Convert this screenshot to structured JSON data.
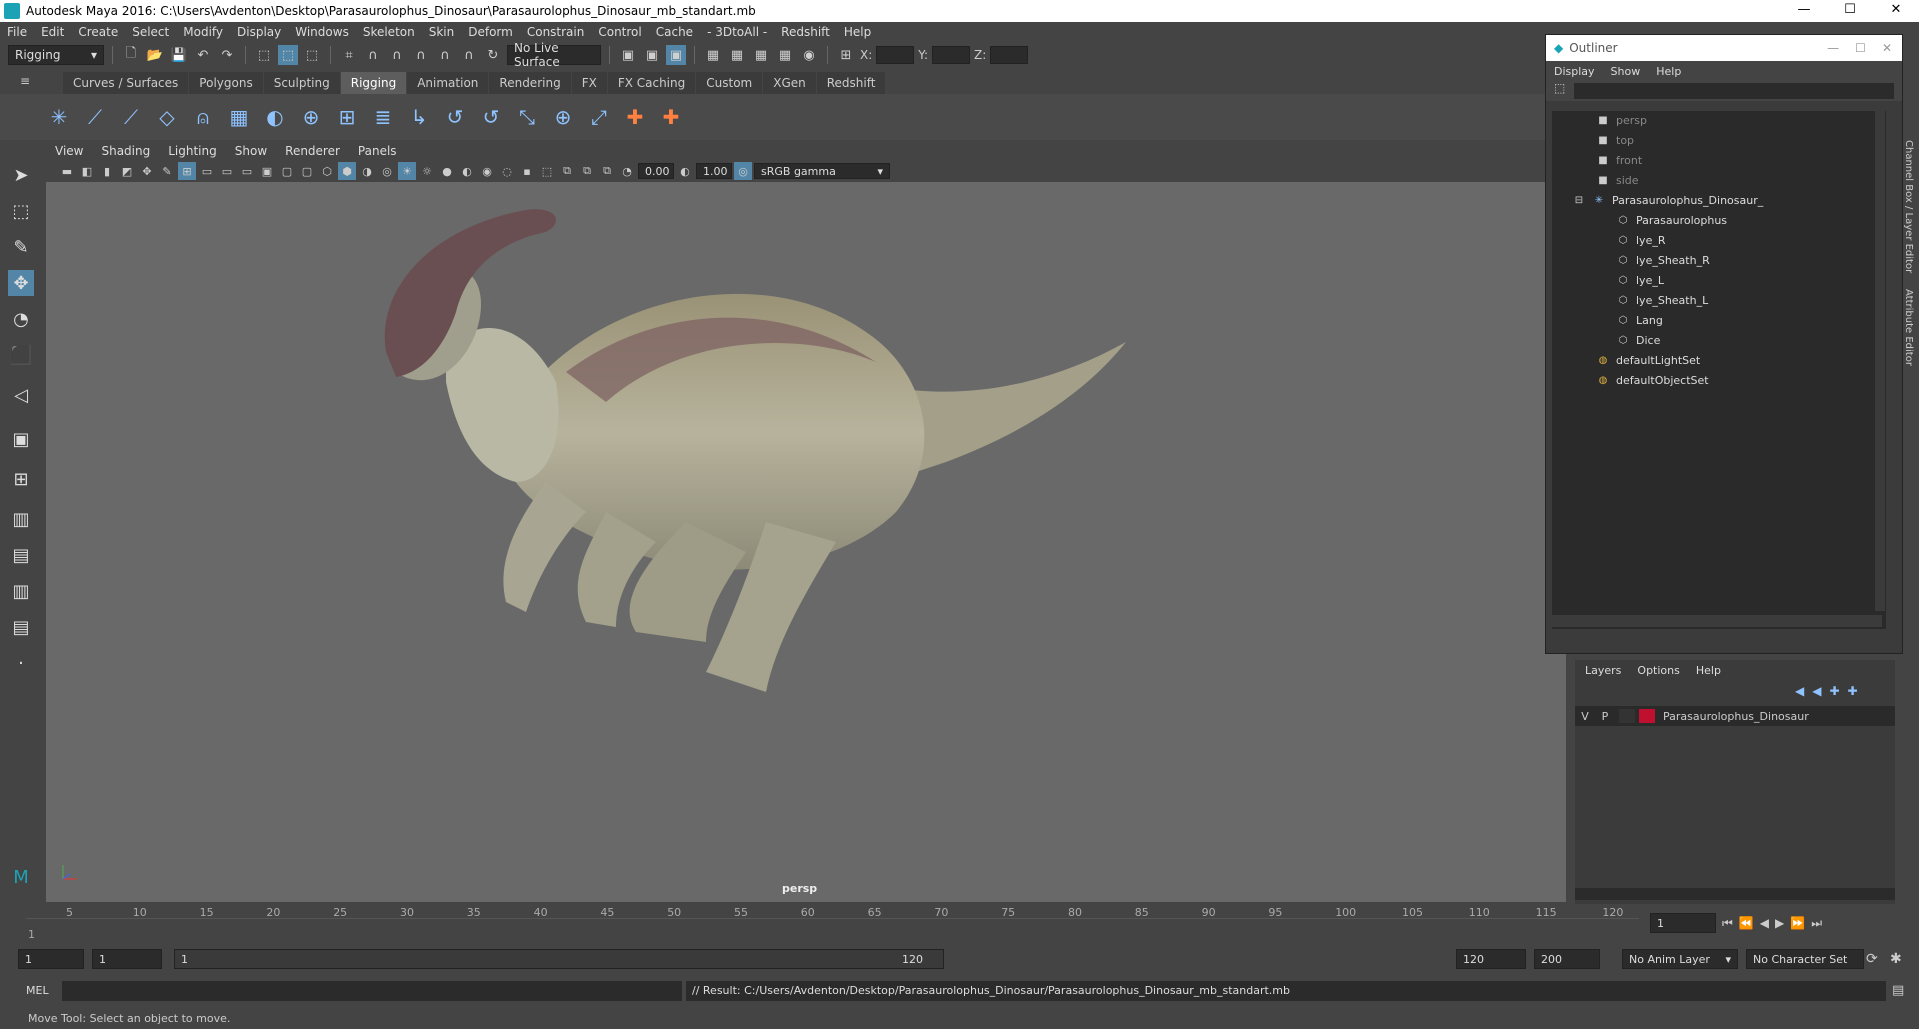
{
  "window": {
    "title": "Autodesk Maya 2016: C:\\Users\\Avdenton\\Desktop\\Parasaurolophus_Dinosaur\\Parasaurolophus_Dinosaur_mb_standart.mb",
    "minimize": "—",
    "maximize": "☐",
    "close": "✕"
  },
  "menubar": [
    "File",
    "Edit",
    "Create",
    "Select",
    "Modify",
    "Display",
    "Windows",
    "Skeleton",
    "Skin",
    "Deform",
    "Constrain",
    "Control",
    "Cache",
    "- 3DtoAll -",
    "Redshift",
    "Help"
  ],
  "status": {
    "mode": "Rigging",
    "live_surface": "No Live Surface",
    "x_label": "X:",
    "y_label": "Y:",
    "z_label": "Z:"
  },
  "shelf_tabs": [
    "Curves / Surfaces",
    "Polygons",
    "Sculpting",
    "Rigging",
    "Animation",
    "Rendering",
    "FX",
    "FX Caching",
    "Custom",
    "XGen",
    "Redshift"
  ],
  "shelf_active": "Rigging",
  "viewport": {
    "menu": [
      "View",
      "Shading",
      "Lighting",
      "Show",
      "Renderer",
      "Panels"
    ],
    "exposure": "0.00",
    "gamma": "1.00",
    "color_space": "sRGB gamma",
    "camera": "persp"
  },
  "timeline": {
    "ticks": [
      "5",
      "10",
      "15",
      "20",
      "25",
      "30",
      "35",
      "40",
      "45",
      "50",
      "55",
      "60",
      "65",
      "70",
      "75",
      "80",
      "85",
      "90",
      "95",
      "100",
      "105",
      "110",
      "115",
      "120"
    ],
    "start_marker": "1",
    "current_frame": "1"
  },
  "range": {
    "start": "1",
    "playback_start": "1",
    "slider_start": "1",
    "slider_end": "120",
    "playback_end": "120",
    "end": "200",
    "anim_layer": "No Anim Layer",
    "char_set": "No Character Set"
  },
  "cmdline": {
    "lang": "MEL",
    "result": "// Result: C:/Users/Avdenton/Desktop/Parasaurolophus_Dinosaur/Parasaurolophus_Dinosaur_mb_standart.mb"
  },
  "helpline": "Move Tool: Select an object to move.",
  "outliner": {
    "title": "Outliner",
    "menu": [
      "Display",
      "Show",
      "Help"
    ],
    "items": [
      {
        "label": "persp",
        "dim": true
      },
      {
        "label": "top",
        "dim": true
      },
      {
        "label": "front",
        "dim": true
      },
      {
        "label": "side",
        "dim": true
      },
      {
        "label": "Parasaurolophus_Dinosaur_",
        "dim": false
      },
      {
        "label": "Parasaurolophus",
        "dim": false
      },
      {
        "label": "lye_R",
        "dim": false
      },
      {
        "label": "lye_Sheath_R",
        "dim": false
      },
      {
        "label": "lye_L",
        "dim": false
      },
      {
        "label": "lye_Sheath_L",
        "dim": false
      },
      {
        "label": "Lang",
        "dim": false
      },
      {
        "label": "Dice",
        "dim": false
      },
      {
        "label": "defaultLightSet",
        "dim": false
      },
      {
        "label": "defaultObjectSet",
        "dim": false
      }
    ]
  },
  "layers": {
    "menu": [
      "Layers",
      "Options",
      "Help"
    ],
    "row": {
      "v": "V",
      "p": "P",
      "name": "Parasaurolophus_Dinosaur",
      "color": "#c01030"
    }
  },
  "side_tabs": [
    "Channel Box / Layer Editor",
    "Attribute Editor"
  ],
  "colors": {
    "accent": "#5285a6",
    "bg": "#444444",
    "viewport": "#696969"
  }
}
